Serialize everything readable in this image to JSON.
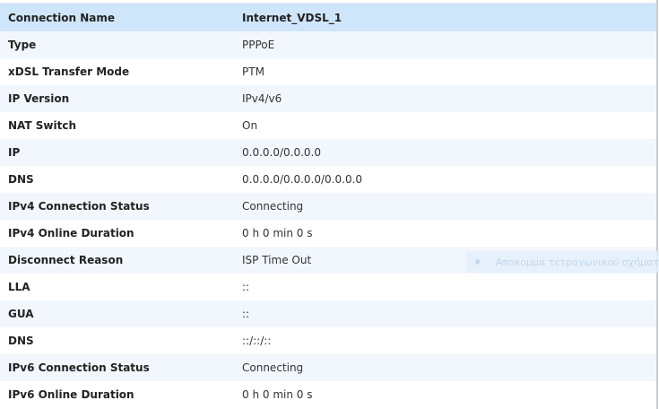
{
  "header": {
    "label": "Connection Name",
    "value": "Internet_VDSL_1"
  },
  "rows": [
    {
      "label": "Type",
      "value": "PPPoE"
    },
    {
      "label": "xDSL Transfer Mode",
      "value": "PTM"
    },
    {
      "label": "IP Version",
      "value": "IPv4/v6"
    },
    {
      "label": "NAT Switch",
      "value": "On"
    },
    {
      "label": "IP",
      "value": "0.0.0.0/0.0.0.0"
    },
    {
      "label": "DNS",
      "value": "0.0.0.0/0.0.0.0/0.0.0.0"
    },
    {
      "label": "IPv4 Connection Status",
      "value": "Connecting"
    },
    {
      "label": "IPv4 Online Duration",
      "value": "0 h 0 min 0 s"
    },
    {
      "label": "Disconnect Reason",
      "value": "ISP Time Out"
    },
    {
      "label": "LLA",
      "value": "::"
    },
    {
      "label": "GUA",
      "value": "::"
    },
    {
      "label": "DNS",
      "value": "::/::/::"
    },
    {
      "label": "IPv6 Connection Status",
      "value": "Connecting"
    },
    {
      "label": "IPv6 Online Duration",
      "value": "0 h 0 min 0 s"
    }
  ],
  "overlay": {
    "text": "Αποκομμα τετραγωνικού σχήματ"
  }
}
